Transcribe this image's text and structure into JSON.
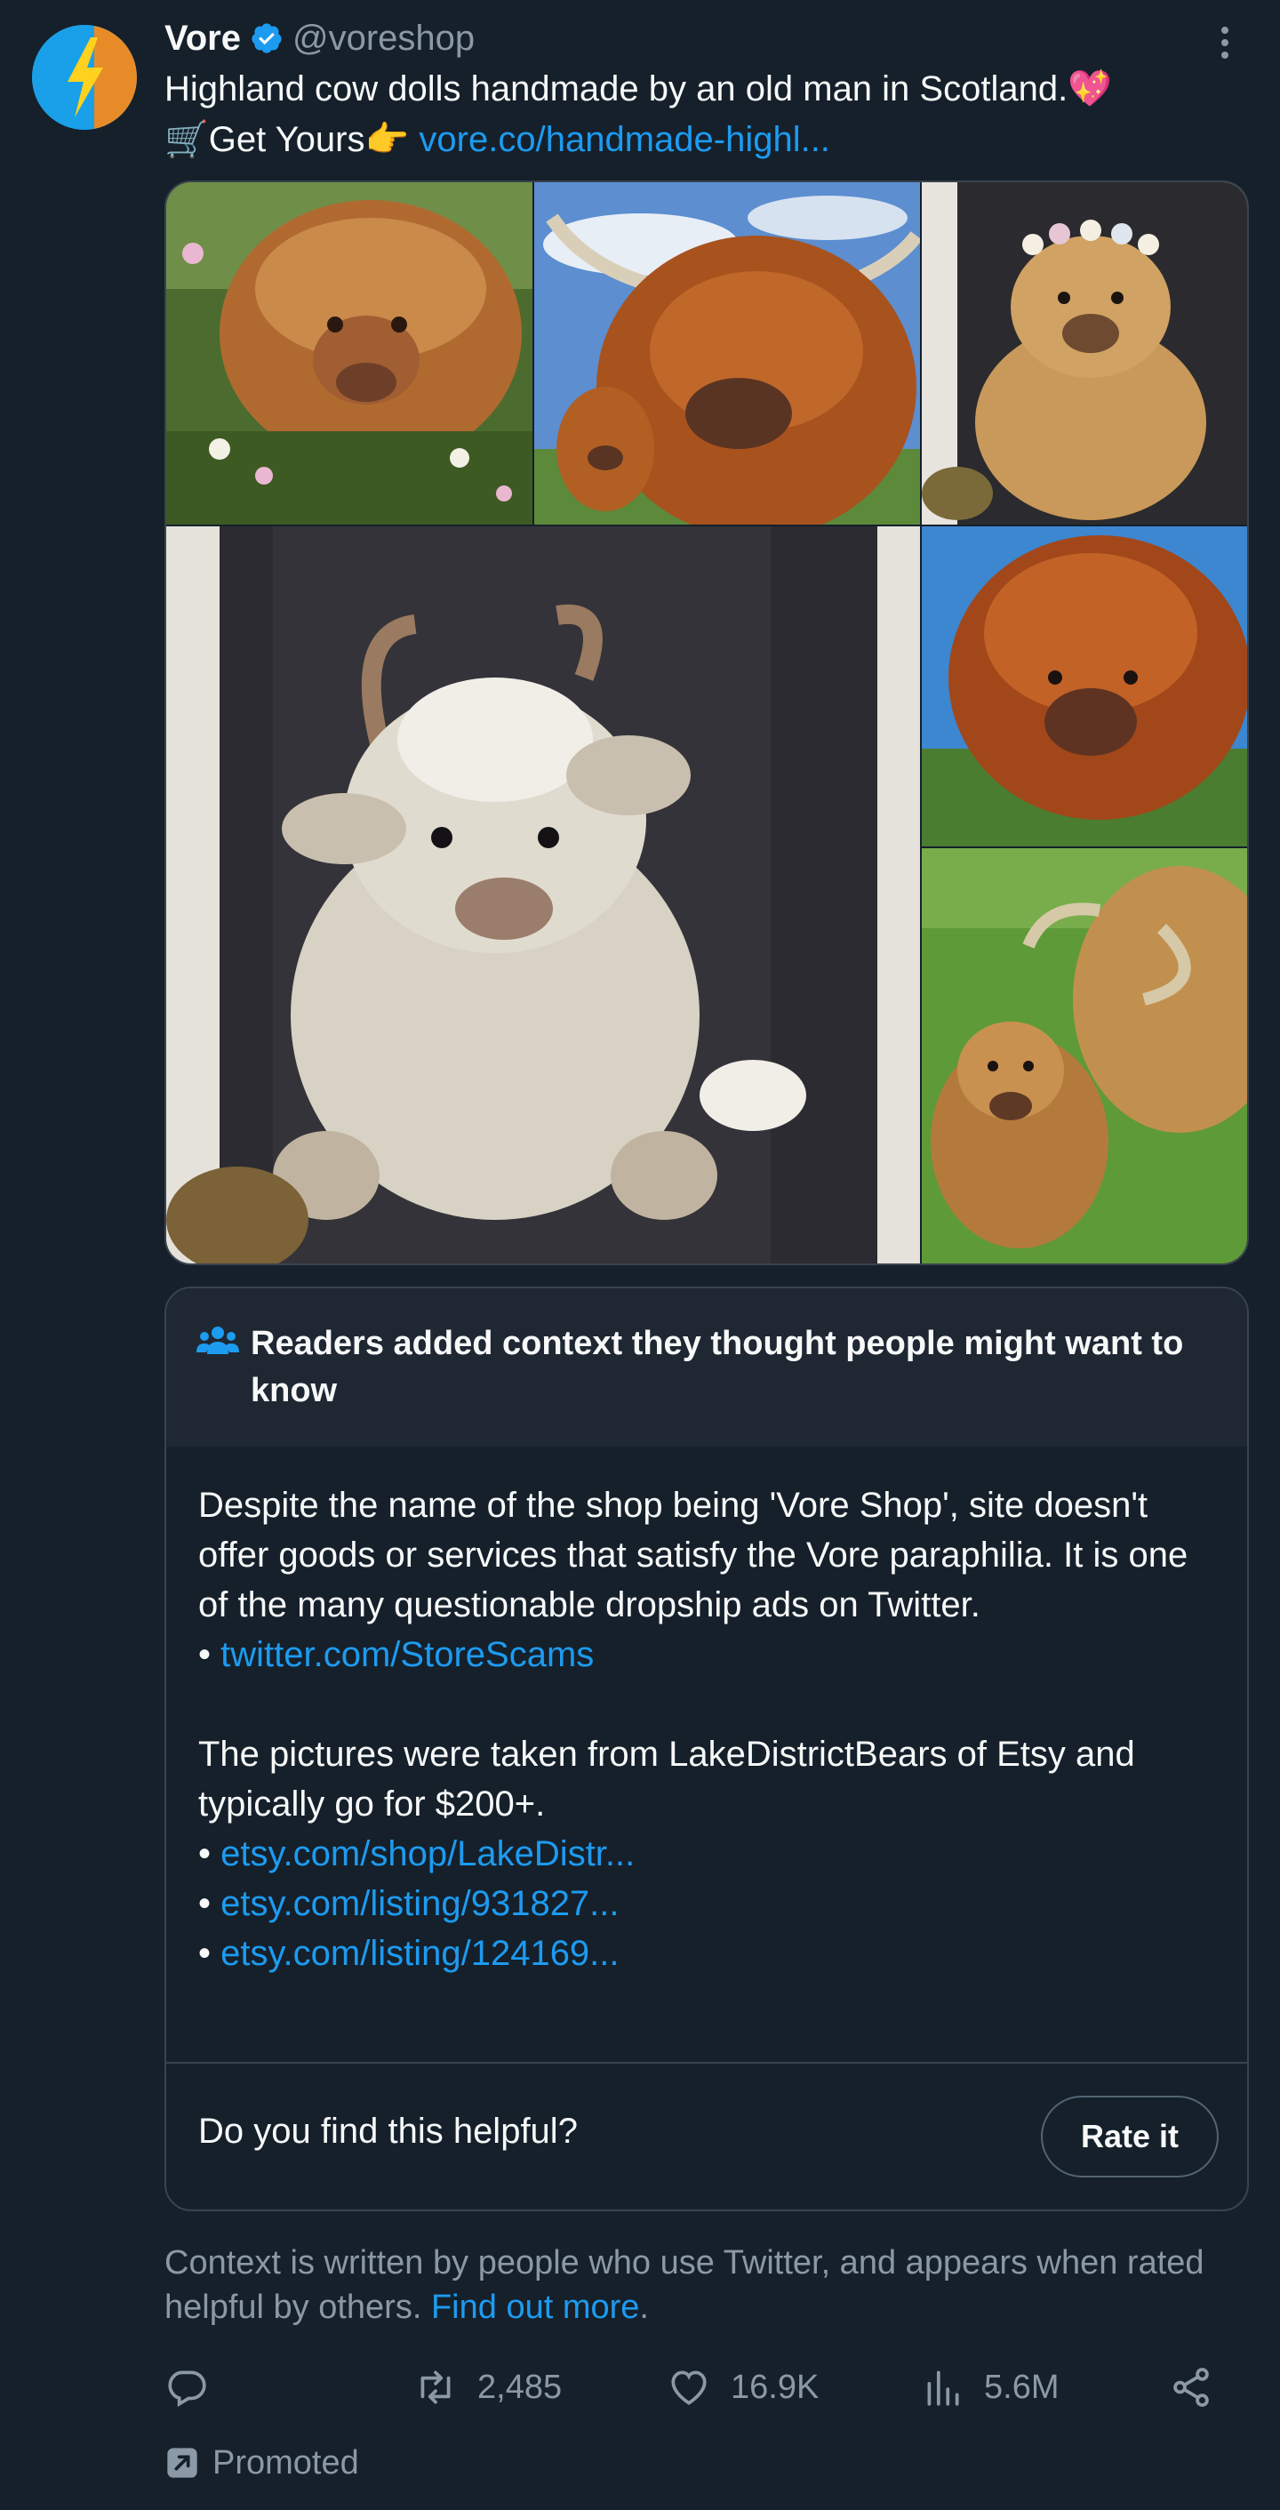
{
  "tweet": {
    "author_name": "Vore",
    "author_handle": "@voreshop",
    "text_line1": "Highland cow dolls handmade by an old man in Scotland.💖",
    "text_line2_prefix": "🛒Get Yours👉",
    "text_link": "vore.co/handmade-highl...",
    "verified_icon": "verified-badge-icon",
    "accent_color": "#1d9bf0"
  },
  "media": {
    "tiles": [
      {
        "name": "photo-calf-in-flowers",
        "icon": "highland-calf-photo"
      },
      {
        "name": "photo-cow-with-horns",
        "icon": "highland-cow-photo"
      },
      {
        "name": "photo-plush-with-flower-crown",
        "icon": "plush-toy-photo"
      },
      {
        "name": "photo-white-plush-held",
        "icon": "plush-toy-photo"
      },
      {
        "name": "photo-brown-cow-closeup",
        "icon": "highland-cow-photo"
      },
      {
        "name": "photo-cow-and-calf-field",
        "icon": "highland-cow-photo"
      }
    ]
  },
  "community_note": {
    "heading": "Readers added context they thought people might want to know",
    "paragraph1": "Despite the name of the shop being 'Vore Shop', site doesn't offer goods or services that satisfy the Vore paraphilia. It is one of the many questionable dropship ads on Twitter.",
    "link1": "twitter.com/StoreScams",
    "paragraph2": "The pictures were taken from LakeDistrictBears of Etsy and typically go for $200+.",
    "links2": [
      "etsy.com/shop/LakeDistr...",
      "etsy.com/listing/931827...",
      "etsy.com/listing/124169..."
    ],
    "bullet": "•",
    "helpful_question": "Do you find this helpful?",
    "rate_button": "Rate it"
  },
  "context_footer": {
    "text": "Context is written by people who use Twitter, and appears when rated helpful by others.",
    "link": "Find out more",
    "period": "."
  },
  "actions": {
    "reply_count": "",
    "retweet_count": "2,485",
    "like_count": "16.9K",
    "views_count": "5.6M"
  },
  "promoted_label": "Promoted",
  "colors": {
    "background": "#15202b",
    "note_header_bg": "#1e2732",
    "border": "#38444d",
    "muted_text": "#8b98a5",
    "link": "#1d9bf0"
  }
}
